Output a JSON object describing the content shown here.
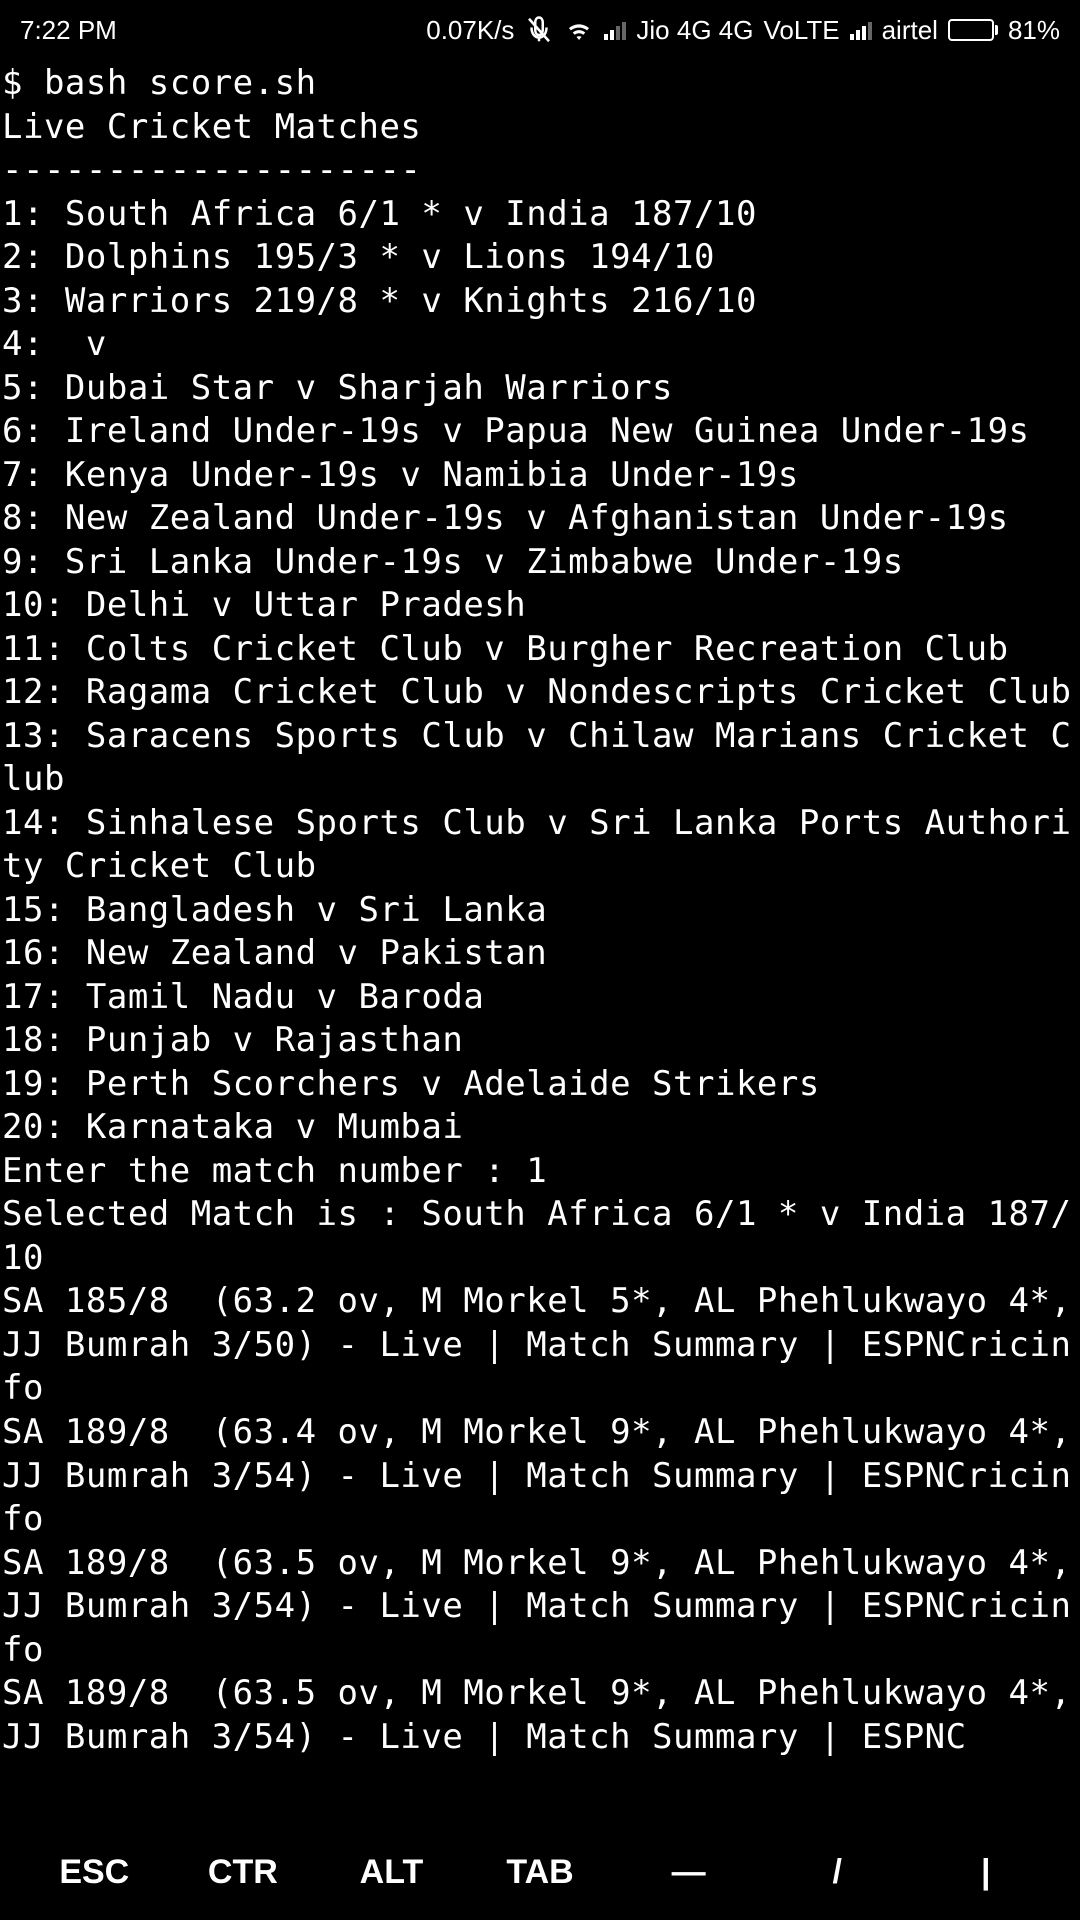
{
  "status_bar": {
    "time": "7:22 PM",
    "data_rate": "0.07K/s",
    "carrier1": "Jio 4G 4G",
    "volte": "VoLTE",
    "carrier2": "airtel",
    "battery": "81%"
  },
  "terminal": {
    "prompt": "$ bash score.sh",
    "header": "Live Cricket Matches",
    "divider": "--------------------",
    "matches": [
      "1: South Africa 6/1 * v India 187/10",
      "2: Dolphins 195/3 * v Lions 194/10",
      "3: Warriors 219/8 * v Knights 216/10",
      "4:  v ",
      "5: Dubai Star v Sharjah Warriors",
      "6: Ireland Under-19s v Papua New Guinea Under-19s",
      "7: Kenya Under-19s v Namibia Under-19s",
      "8: New Zealand Under-19s v Afghanistan Under-19s",
      "9: Sri Lanka Under-19s v Zimbabwe Under-19s",
      "10: Delhi v Uttar Pradesh",
      "11: Colts Cricket Club v Burgher Recreation Club",
      "12: Ragama Cricket Club v Nondescripts Cricket Club",
      "13: Saracens Sports Club v Chilaw Marians Cricket Club",
      "14: Sinhalese Sports Club v Sri Lanka Ports Authority Cricket Club",
      "15: Bangladesh v Sri Lanka",
      "16: New Zealand v Pakistan",
      "17: Tamil Nadu v Baroda",
      "18: Punjab v Rajasthan",
      "19: Perth Scorchers v Adelaide Strikers",
      "20: Karnataka v Mumbai"
    ],
    "input_prompt": "Enter the match number : 1",
    "selected": "Selected Match is : South Africa 6/1 * v India 187/10",
    "updates": [
      "SA 185/8  (63.2 ov, M Morkel 5*, AL Phehlukwayo 4*, JJ Bumrah 3/50) - Live | Match Summary | ESPNCricinfo",
      "SA 189/8  (63.4 ov, M Morkel 9*, AL Phehlukwayo 4*, JJ Bumrah 3/54) - Live | Match Summary | ESPNCricinfo",
      "SA 189/8  (63.5 ov, M Morkel 9*, AL Phehlukwayo 4*, JJ Bumrah 3/54) - Live | Match Summary | ESPNCricinfo",
      "SA 189/8  (63.5 ov, M Morkel 9*, AL Phehlukwayo 4*, JJ Bumrah 3/54) - Live | Match Summary | ESPNC"
    ]
  },
  "bottom_bar": {
    "esc": "ESC",
    "ctr": "CTR",
    "alt": "ALT",
    "tab": "TAB",
    "dash": "—",
    "slash": "/",
    "pipe": "|"
  }
}
